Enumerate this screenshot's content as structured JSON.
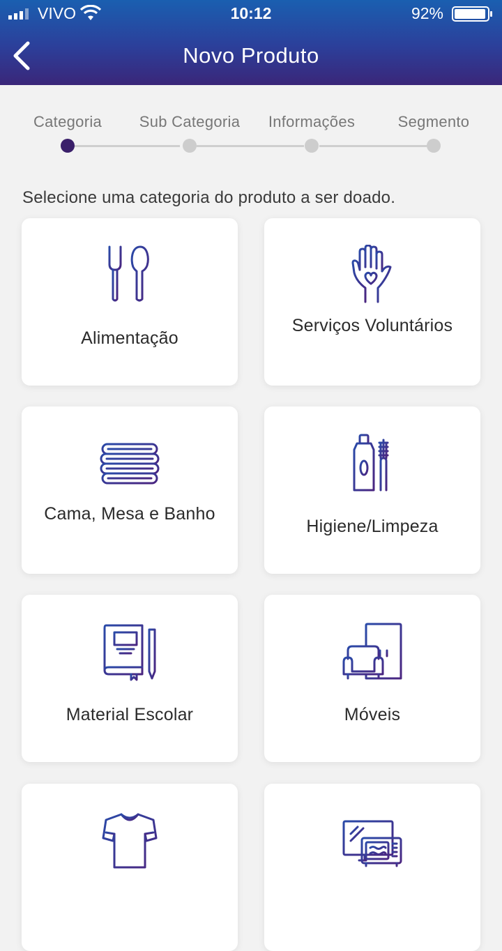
{
  "status_bar": {
    "carrier": "VIVO",
    "time": "10:12",
    "battery": "92%"
  },
  "header": {
    "title": "Novo Produto"
  },
  "steps": [
    {
      "label": "Categoria",
      "active": true
    },
    {
      "label": "Sub Categoria",
      "active": false
    },
    {
      "label": "Informações",
      "active": false
    },
    {
      "label": "Segmento",
      "active": false
    }
  ],
  "instruction": "Selecione uma categoria do produto a ser doado.",
  "categories": [
    {
      "label": "Alimentação",
      "icon": "fork-spoon-icon"
    },
    {
      "label": "Serviços Voluntários",
      "icon": "hand-heart-icon"
    },
    {
      "label": "Cama, Mesa e Banho",
      "icon": "folded-towels-icon"
    },
    {
      "label": "Higiene/Limpeza",
      "icon": "toothpaste-brush-icon"
    },
    {
      "label": "Material Escolar",
      "icon": "notebook-pencil-icon"
    },
    {
      "label": "Móveis",
      "icon": "sofa-wardrobe-icon"
    },
    {
      "label": "",
      "icon": "tshirt-icon"
    },
    {
      "label": "",
      "icon": "tv-microwave-icon"
    }
  ],
  "colors": {
    "header_top": "#1a5fb0",
    "header_bottom": "#3a2679",
    "icon_gradient_start": "#2a4aa8",
    "icon_gradient_end": "#4a2580",
    "active_step": "#3a1f6a"
  }
}
